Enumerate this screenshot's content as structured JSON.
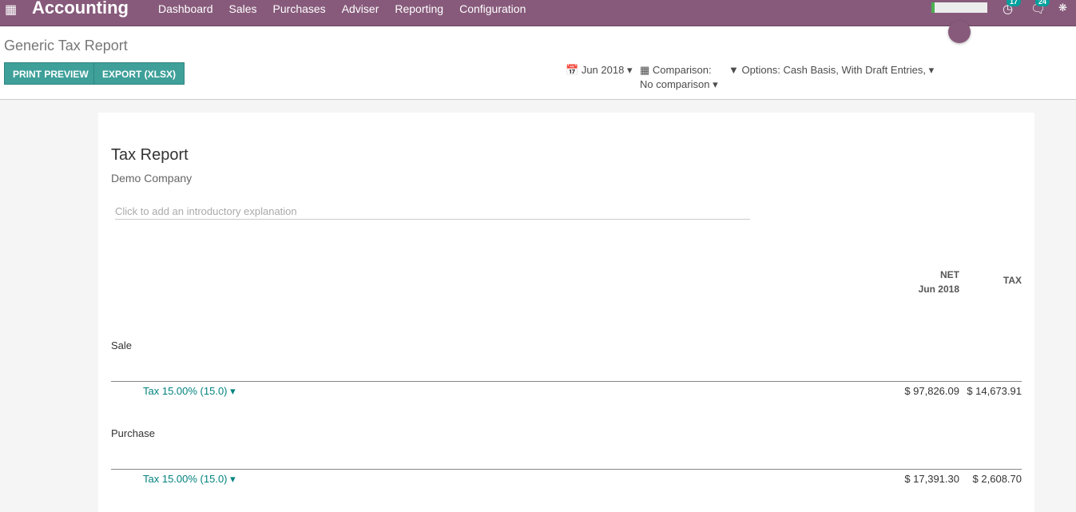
{
  "topbar": {
    "app_name": "Accounting",
    "menu": [
      "Dashboard",
      "Sales",
      "Purchases",
      "Adviser",
      "Reporting",
      "Configuration"
    ],
    "activity_count": "17",
    "message_count": "24",
    "accent": "#875a7b"
  },
  "control": {
    "title": "Generic Tax Report",
    "print_preview": "PRINT PREVIEW",
    "export": "EXPORT (XLSX)",
    "date_filter": "Jun 2018",
    "comparison_label": "Comparison:",
    "comparison_value": "No comparison",
    "options": "Options: Cash Basis, With Draft Entries,"
  },
  "report": {
    "title": "Tax Report",
    "company": "Demo Company",
    "intro_placeholder": "Click to add an introductory explanation",
    "columns": [
      {
        "label": "NET",
        "sub": "Jun 2018"
      },
      {
        "label": "TAX"
      }
    ],
    "sections": [
      {
        "name": "Sale",
        "line": "Tax 15.00% (15.0)",
        "net": "$ 97,826.09",
        "tax": "$ 14,673.91"
      },
      {
        "name": "Purchase",
        "line": "Tax 15.00% (15.0)",
        "net": "$ 17,391.30",
        "tax": "$ 2,608.70"
      }
    ]
  }
}
